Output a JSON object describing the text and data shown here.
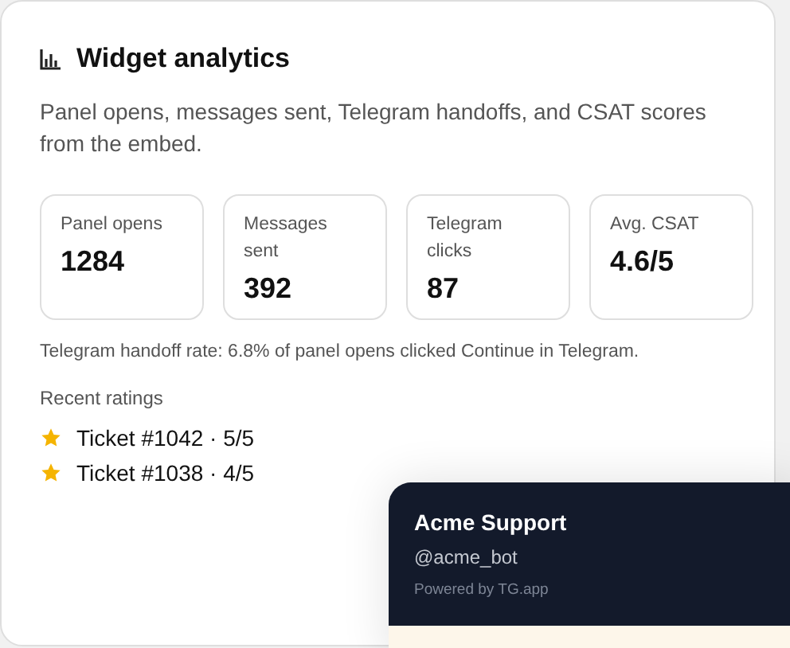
{
  "card": {
    "title": "Widget analytics",
    "description": "Panel opens, messages sent, Telegram handoffs, and CSAT scores from the embed.",
    "metrics": [
      {
        "label": "Panel opens",
        "value": "1284"
      },
      {
        "label": "Messages sent",
        "value": "392"
      },
      {
        "label": "Telegram clicks",
        "value": "87"
      },
      {
        "label": "Avg. CSAT",
        "value": "4.6/5"
      }
    ],
    "handoff_note": "Telegram handoff rate: 6.8% of panel opens clicked Continue in Telegram.",
    "ratings_heading": "Recent ratings",
    "ratings": [
      {
        "text": "Ticket #1042 · 5/5"
      },
      {
        "text": "Ticket #1038 · 4/5"
      }
    ]
  },
  "widget_panel": {
    "title": "Acme Support",
    "handle": "@acme_bot",
    "footer": "Powered by TG.app"
  }
}
